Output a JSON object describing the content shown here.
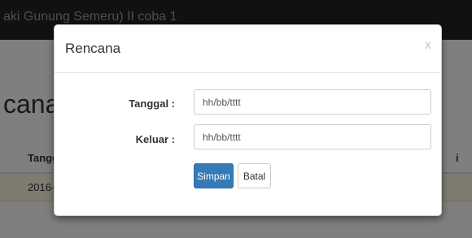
{
  "background": {
    "topbar_title": "aki Gunung Semeru) II coba 1",
    "page_heading": "cana",
    "table": {
      "header_left": "Tangg",
      "header_right": "i",
      "row_left": "2016-"
    }
  },
  "modal": {
    "title": "Rencana",
    "close_label": "x",
    "fields": [
      {
        "label": "Tanggal :",
        "placeholder": "hh/bb/tttt",
        "value": ""
      },
      {
        "label": "Keluar :",
        "placeholder": "hh/bb/tttt",
        "value": ""
      }
    ],
    "buttons": {
      "save": "Simpan",
      "cancel": "Batal"
    }
  },
  "colors": {
    "primary": "#337ab7",
    "topbar": "#222222",
    "warning_row": "#fcf8e3"
  },
  "icons": {
    "close": "close-icon"
  }
}
